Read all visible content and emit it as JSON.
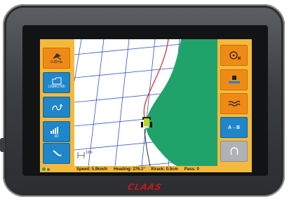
{
  "left_menu": {
    "tiles": [
      {
        "icon": "field-area-icon",
        "caption": "0.28 ha"
      },
      {
        "icon": "field-folder-icon",
        "caption": "LISMO765"
      },
      {
        "icon": "headland-turn-icon",
        "caption": ""
      },
      {
        "icon": "gps-signal-3d-icon",
        "caption": "3D"
      },
      {
        "icon": "tools-wrench-icon",
        "caption": ""
      }
    ]
  },
  "right_menu": {
    "tiles": [
      {
        "icon": "steering-wheel-off-icon"
      },
      {
        "icon": "implement-section-icon"
      },
      {
        "icon": "curve-contour-icon"
      },
      {
        "icon": "ab-line-icon",
        "caption": "A→B"
      },
      {
        "icon": "headland-shape-icon"
      }
    ]
  },
  "map": {
    "scale_label": "10m"
  },
  "status_bar": {
    "speed": "Speed: 5.9km/h",
    "heading": "Heading: 276.1°",
    "xtrack": "Xtrack: 0.5cm",
    "pass": "Pass: 0"
  },
  "brand": "CLAAS",
  "colors": {
    "panel": "#f4b93b",
    "tile_orange": "#f08a16",
    "tile_blue": "#1e86c9",
    "tile_grey": "#aeb1b5",
    "coverage": "#1fa36b",
    "guidance_line": "#d42a1e",
    "brand_red": "#c4161c"
  }
}
